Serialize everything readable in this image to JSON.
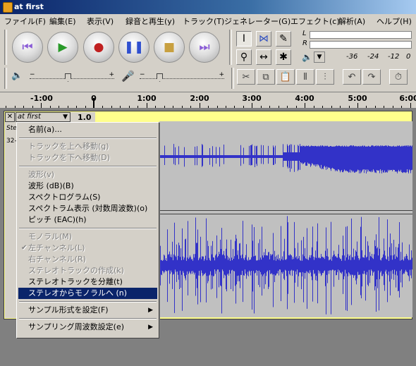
{
  "window": {
    "title": "at first"
  },
  "menubar": [
    "ファイル(F)",
    "編集(E)",
    "表示(V)",
    "録音と再生(y)",
    "トラック(T)",
    "ジェネレーター(G)",
    "エフェクト(c)",
    "解析(A)",
    "ヘルプ(H)"
  ],
  "transport": [
    {
      "name": "skip-start",
      "glyph": "⏮",
      "color": "#8a5cd6"
    },
    {
      "name": "play",
      "glyph": "▶",
      "color": "#2a9a2a"
    },
    {
      "name": "record",
      "glyph": "●",
      "color": "#c02020"
    },
    {
      "name": "pause",
      "glyph": "❚❚",
      "color": "#3050d0"
    },
    {
      "name": "stop",
      "glyph": "■",
      "color": "#c8a040"
    },
    {
      "name": "skip-end",
      "glyph": "⏭",
      "color": "#8a5cd6"
    }
  ],
  "meter": {
    "left_label": "L",
    "right_label": "R",
    "scale": [
      "-36",
      "-24",
      "-12",
      "0"
    ]
  },
  "ruler": {
    "labels": [
      "-1:00",
      "0",
      "1:00",
      "2:00",
      "3:00",
      "4:00",
      "5:00",
      "6:00"
    ]
  },
  "track": {
    "name": "at first",
    "gain_label": "1.0",
    "info1": "Ste",
    "info2": "32-"
  },
  "context_menu": {
    "items": [
      {
        "label": "名前(a)...",
        "disabled": false,
        "checked": false,
        "submenu": false,
        "highlighted": false
      },
      {
        "sep": true
      },
      {
        "label": "トラックを上へ移動(g)",
        "disabled": true,
        "checked": false,
        "submenu": false,
        "highlighted": false
      },
      {
        "label": "トラックを下へ移動(D)",
        "disabled": true,
        "checked": false,
        "submenu": false,
        "highlighted": false
      },
      {
        "sep": true
      },
      {
        "label": "波形(v)",
        "disabled": true,
        "checked": false,
        "submenu": false,
        "highlighted": false
      },
      {
        "label": "波形 (dB)(B)",
        "disabled": false,
        "checked": false,
        "submenu": false,
        "highlighted": false
      },
      {
        "label": "スペクトログラム(S)",
        "disabled": false,
        "checked": false,
        "submenu": false,
        "highlighted": false
      },
      {
        "label": "スペクトラム表示 (対数周波数)(o)",
        "disabled": false,
        "checked": false,
        "submenu": false,
        "highlighted": false
      },
      {
        "label": "ピッチ (EAC)(h)",
        "disabled": false,
        "checked": false,
        "submenu": false,
        "highlighted": false
      },
      {
        "sep": true
      },
      {
        "label": "モノラル(M)",
        "disabled": true,
        "checked": false,
        "submenu": false,
        "highlighted": false
      },
      {
        "label": "左チャンネル(L)",
        "disabled": true,
        "checked": true,
        "submenu": false,
        "highlighted": false
      },
      {
        "label": "右チャンネル(R)",
        "disabled": true,
        "checked": false,
        "submenu": false,
        "highlighted": false
      },
      {
        "label": "ステレオトラックの作成(k)",
        "disabled": true,
        "checked": false,
        "submenu": false,
        "highlighted": false
      },
      {
        "label": "ステレオトラックを分離(t)",
        "disabled": false,
        "checked": false,
        "submenu": false,
        "highlighted": false
      },
      {
        "label": "ステレオからモノラルへ (n)",
        "disabled": false,
        "checked": false,
        "submenu": false,
        "highlighted": true
      },
      {
        "sep": true
      },
      {
        "label": "サンプル形式を設定(F)",
        "disabled": false,
        "checked": false,
        "submenu": true,
        "highlighted": false
      },
      {
        "sep": true
      },
      {
        "label": "サンプリング周波数設定(e)",
        "disabled": false,
        "checked": false,
        "submenu": true,
        "highlighted": false
      }
    ]
  },
  "colors": {
    "waveform": "#3232c8",
    "selection_border": "#ffff8c",
    "menu_highlight": "#0a246a"
  }
}
